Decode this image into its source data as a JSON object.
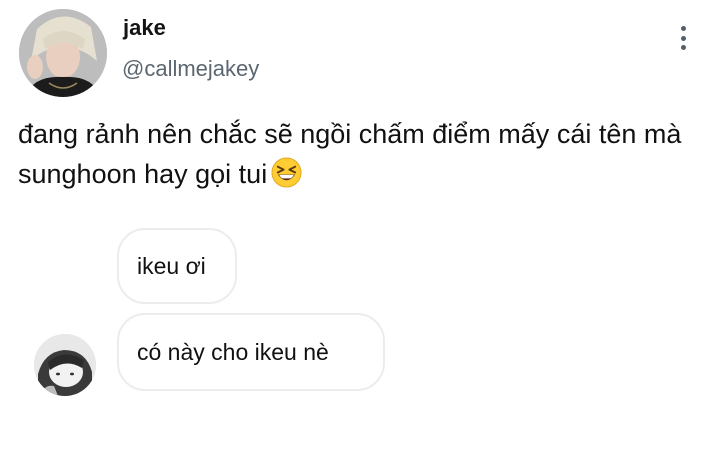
{
  "tweet": {
    "display_name": "jake",
    "username": "@callmejakey",
    "text": "đang rảnh nên chắc sẽ ngồi chấm điểm mấy cái tên mà sunghoon hay gọi tui",
    "emoji": "grinning-squinting-face"
  },
  "embedded_image": {
    "messages": [
      {
        "text": "ikeu ơi"
      },
      {
        "text": "có này cho ikeu nè"
      }
    ]
  },
  "colors": {
    "text": "#111111",
    "secondary_text": "#5b6670",
    "bubble_border": "#ececec",
    "emoji_yellow": "#ffcc33"
  }
}
